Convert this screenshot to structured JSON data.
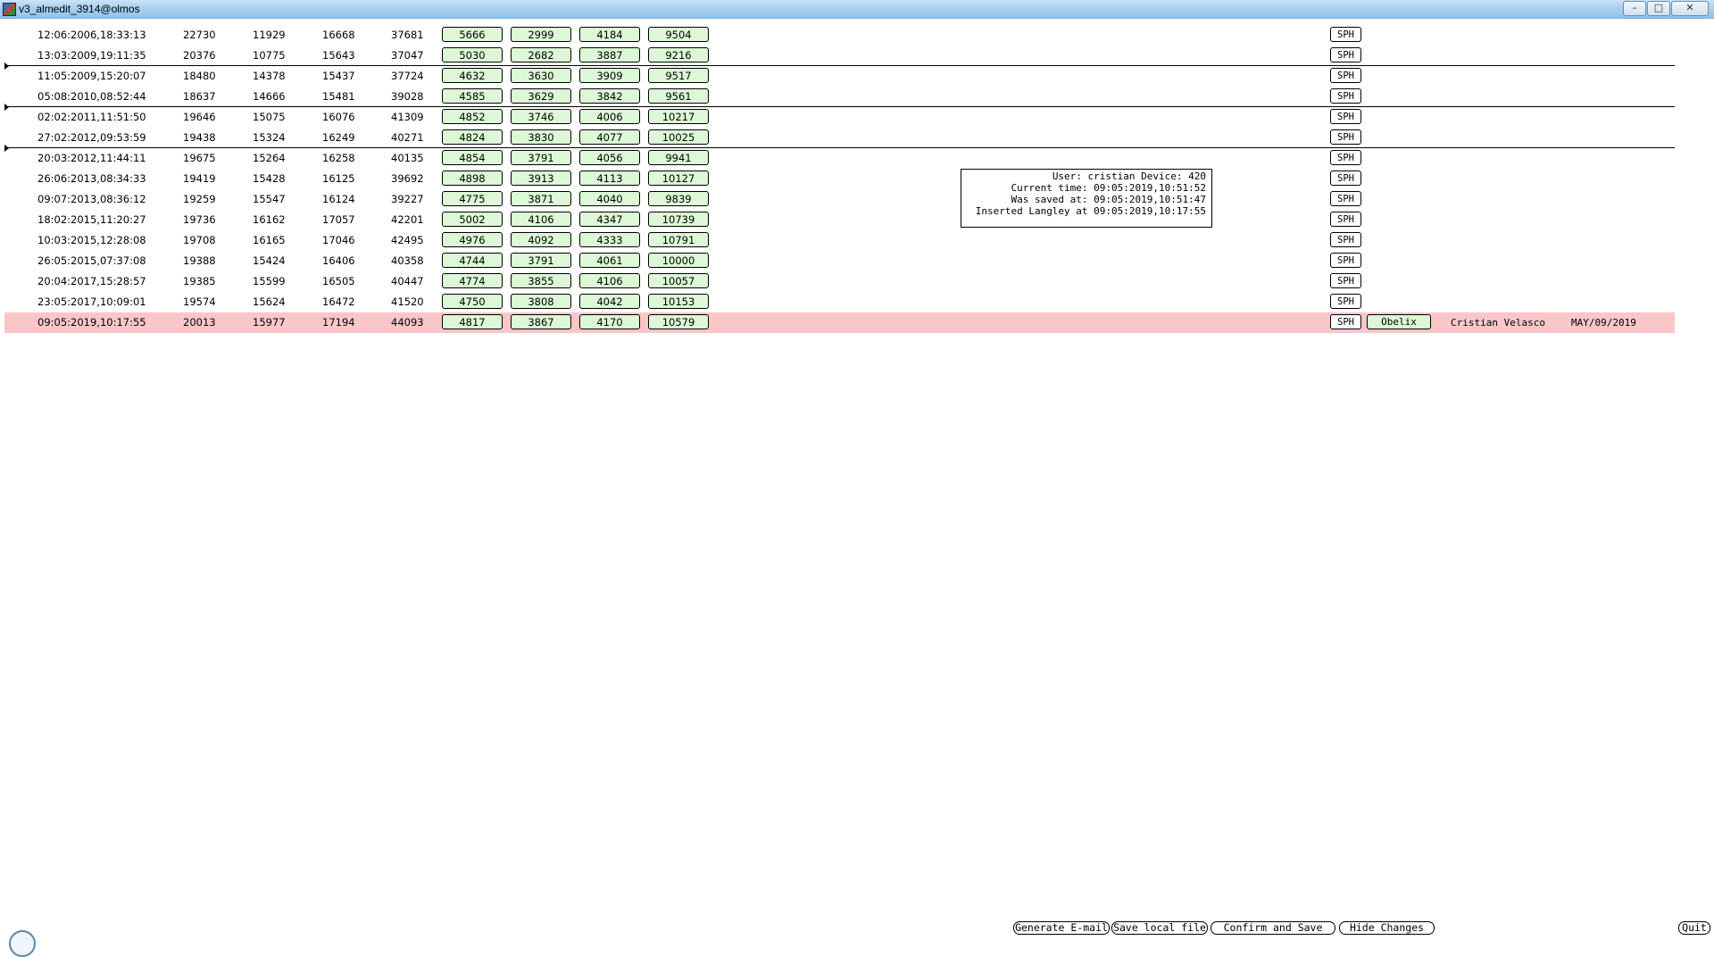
{
  "window": {
    "title": "v3_almedit_3914@olmos",
    "minimize": "–",
    "maximize": "□",
    "close": "✕"
  },
  "rows": [
    {
      "date": "12:06:2006,18:33:13",
      "n": [
        "22730",
        "11929",
        "16668",
        "37681"
      ],
      "g": [
        "5666",
        "2999",
        "4184",
        "9504"
      ],
      "sph": "SPH"
    },
    {
      "date": "13:03:2009,19:11:35",
      "n": [
        "20376",
        "10775",
        "15643",
        "37047"
      ],
      "g": [
        "5030",
        "2682",
        "3887",
        "9216"
      ],
      "sph": "SPH"
    },
    {
      "date": "11:05:2009,15:20:07",
      "n": [
        "18480",
        "14378",
        "15437",
        "37724"
      ],
      "g": [
        "4632",
        "3630",
        "3909",
        "9517"
      ],
      "sph": "SPH"
    },
    {
      "date": "05:08:2010,08:52:44",
      "n": [
        "18637",
        "14666",
        "15481",
        "39028"
      ],
      "g": [
        "4585",
        "3629",
        "3842",
        "9561"
      ],
      "sph": "SPH"
    },
    {
      "date": "02:02:2011,11:51:50",
      "n": [
        "19646",
        "15075",
        "16076",
        "41309"
      ],
      "g": [
        "4852",
        "3746",
        "4006",
        "10217"
      ],
      "sph": "SPH"
    },
    {
      "date": "27:02:2012,09:53:59",
      "n": [
        "19438",
        "15324",
        "16249",
        "40271"
      ],
      "g": [
        "4824",
        "3830",
        "4077",
        "10025"
      ],
      "sph": "SPH"
    },
    {
      "date": "20:03:2012,11:44:11",
      "n": [
        "19675",
        "15264",
        "16258",
        "40135"
      ],
      "g": [
        "4854",
        "3791",
        "4056",
        "9941"
      ],
      "sph": "SPH"
    },
    {
      "date": "26:06:2013,08:34:33",
      "n": [
        "19419",
        "15428",
        "16125",
        "39692"
      ],
      "g": [
        "4898",
        "3913",
        "4113",
        "10127"
      ],
      "sph": "SPH"
    },
    {
      "date": "09:07:2013,08:36:12",
      "n": [
        "19259",
        "15547",
        "16124",
        "39227"
      ],
      "g": [
        "4775",
        "3871",
        "4040",
        "9839"
      ],
      "sph": "SPH"
    },
    {
      "date": "18:02:2015,11:20:27",
      "n": [
        "19736",
        "16162",
        "17057",
        "42201"
      ],
      "g": [
        "5002",
        "4106",
        "4347",
        "10739"
      ],
      "sph": "SPH"
    },
    {
      "date": "10:03:2015,12:28:08",
      "n": [
        "19708",
        "16165",
        "17046",
        "42495"
      ],
      "g": [
        "4976",
        "4092",
        "4333",
        "10791"
      ],
      "sph": "SPH"
    },
    {
      "date": "26:05:2015,07:37:08",
      "n": [
        "19388",
        "15424",
        "16406",
        "40358"
      ],
      "g": [
        "4744",
        "3791",
        "4061",
        "10000"
      ],
      "sph": "SPH"
    },
    {
      "date": "20:04:2017,15:28:57",
      "n": [
        "19385",
        "15599",
        "16505",
        "40447"
      ],
      "g": [
        "4774",
        "3855",
        "4106",
        "10057"
      ],
      "sph": "SPH"
    },
    {
      "date": "23:05:2017,10:09:01",
      "n": [
        "19574",
        "15624",
        "16472",
        "41520"
      ],
      "g": [
        "4750",
        "3808",
        "4042",
        "10153"
      ],
      "sph": "SPH"
    },
    {
      "date": "09:05:2019,10:17:55",
      "n": [
        "20013",
        "15977",
        "17194",
        "44093"
      ],
      "g": [
        "4817",
        "3867",
        "4170",
        "10579"
      ],
      "sph": "SPH",
      "selected": true,
      "extra_button": "Obelix",
      "user": "Cristian Velasco",
      "user_date": "MAY/09/2019"
    }
  ],
  "info_box": {
    "line1": "User: cristian Device: 420",
    "line2": "Current time: 09:05:2019,10:51:52",
    "line3": "Was saved at: 09:05:2019,10:51:47",
    "line4": "Inserted Langley at 09:05:2019,10:17:55"
  },
  "bottom_buttons": {
    "generate_email": "Generate E-mail",
    "save_local": "Save local file",
    "confirm_save": "Confirm and Save",
    "hide_changes": "Hide Changes",
    "quit": "Quit"
  },
  "colors": {
    "selected_row": "#fbc6c8",
    "value_button": "#dcf8d6",
    "titlebar": "#a9d1f0"
  }
}
